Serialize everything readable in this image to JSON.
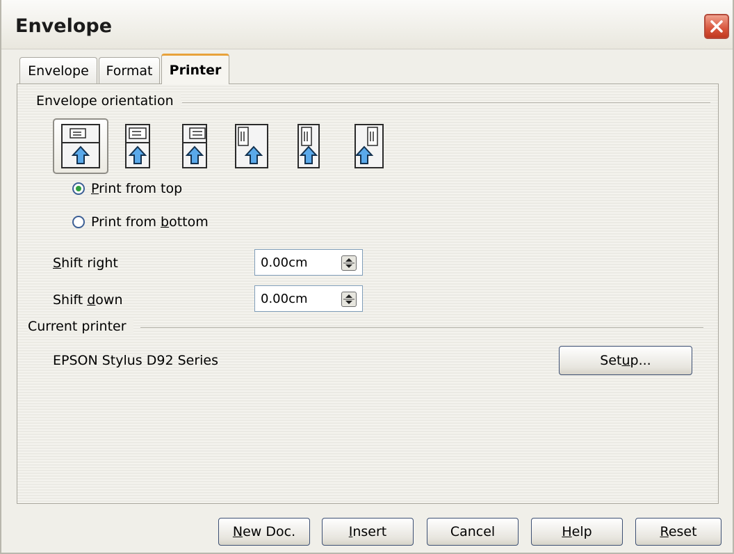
{
  "window": {
    "title": "Envelope"
  },
  "tabs": [
    {
      "label": "Envelope",
      "active": false
    },
    {
      "label": "Format",
      "active": false
    },
    {
      "label": "Printer",
      "active": true
    }
  ],
  "orientation": {
    "section_label": "Envelope orientation",
    "options": [
      {
        "name": "horizontal-left",
        "selected": true
      },
      {
        "name": "horizontal-center",
        "selected": false
      },
      {
        "name": "horizontal-right",
        "selected": false
      },
      {
        "name": "vertical-left",
        "selected": false
      },
      {
        "name": "vertical-center",
        "selected": false
      },
      {
        "name": "vertical-right",
        "selected": false
      }
    ],
    "print_from_top": {
      "pre": "",
      "mn": "P",
      "post": "rint from top",
      "checked": true
    },
    "print_from_bottom": {
      "pre": "Print from ",
      "mn": "b",
      "post": "ottom",
      "checked": false
    }
  },
  "shift_right": {
    "label_pre": "",
    "label_mn": "S",
    "label_post": "hift right",
    "value": "0.00cm"
  },
  "shift_down": {
    "label_pre": "Shift ",
    "label_mn": "d",
    "label_post": "own",
    "value": "0.00cm"
  },
  "current_printer": {
    "section_label": "Current printer",
    "name": "EPSON Stylus D92 Series",
    "setup": {
      "pre": "Set",
      "mn": "u",
      "post": "p..."
    }
  },
  "buttons": {
    "new_doc": {
      "pre": "",
      "mn": "N",
      "post": "ew Doc."
    },
    "insert": {
      "pre": "",
      "mn": "I",
      "post": "nsert"
    },
    "cancel": {
      "pre": "Cancel",
      "mn": "",
      "post": ""
    },
    "help": {
      "pre": "",
      "mn": "H",
      "post": "elp"
    },
    "reset": {
      "pre": "",
      "mn": "R",
      "post": "eset"
    }
  },
  "colors": {
    "dialog_bg": "#f0efe9",
    "active_tab_accent": "#e8a23a",
    "close_button": "#d8553c",
    "arrow_blue": "#3a8ad6"
  }
}
